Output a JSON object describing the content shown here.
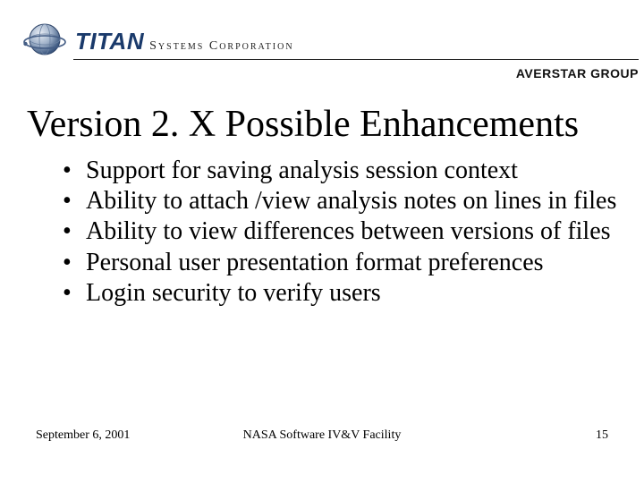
{
  "header": {
    "brand_main": "TITAN",
    "brand_sub": "Systems Corporation",
    "group": "AVERSTAR GROUP"
  },
  "title": "Version 2. X Possible Enhancements",
  "bullets": [
    "Support for saving analysis session context",
    "Ability to attach /view analysis notes on lines in files",
    "Ability to view differences between versions of files",
    "Personal user presentation format preferences",
    "Login security to verify users"
  ],
  "footer": {
    "date": "September 6, 2001",
    "center": "NASA Software IV&V Facility",
    "page": "15"
  }
}
